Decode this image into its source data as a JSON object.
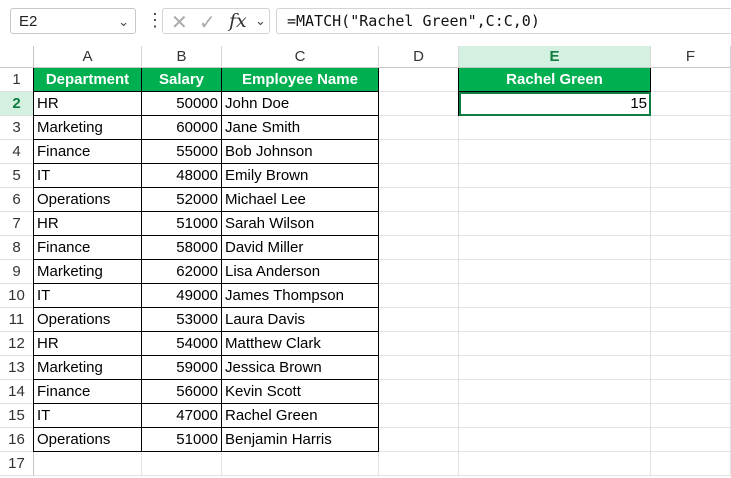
{
  "formula_bar": {
    "name_box": "E2",
    "formula": "=MATCH(\"Rachel Green\",C:C,0)",
    "icons": [
      "chevron-down-icon",
      "vertical-dots-icon",
      "cancel-icon",
      "enter-icon",
      "function-icon"
    ]
  },
  "columns": [
    "A",
    "B",
    "C",
    "D",
    "E",
    "F"
  ],
  "rows": [
    "1",
    "2",
    "3",
    "4",
    "5",
    "6",
    "7",
    "8",
    "9",
    "10",
    "11",
    "12",
    "13",
    "14",
    "15",
    "16",
    "17"
  ],
  "table": {
    "headers": [
      "Department",
      "Salary",
      "Employee Name"
    ],
    "records": [
      [
        "HR",
        "50000",
        "John Doe"
      ],
      [
        "Marketing",
        "60000",
        "Jane Smith"
      ],
      [
        "Finance",
        "55000",
        "Bob Johnson"
      ],
      [
        "IT",
        "48000",
        "Emily Brown"
      ],
      [
        "Operations",
        "52000",
        "Michael Lee"
      ],
      [
        "HR",
        "51000",
        "Sarah Wilson"
      ],
      [
        "Finance",
        "58000",
        "David Miller"
      ],
      [
        "Marketing",
        "62000",
        "Lisa Anderson"
      ],
      [
        "IT",
        "49000",
        "James Thompson"
      ],
      [
        "Operations",
        "53000",
        "Laura Davis"
      ],
      [
        "HR",
        "54000",
        "Matthew Clark"
      ],
      [
        "Marketing",
        "59000",
        "Jessica Brown"
      ],
      [
        "Finance",
        "56000",
        "Kevin Scott"
      ],
      [
        "IT",
        "47000",
        "Rachel Green"
      ],
      [
        "Operations",
        "51000",
        "Benjamin Harris"
      ]
    ]
  },
  "lookup": {
    "header": "Rachel Green",
    "result": "15"
  },
  "colors": {
    "header_fill": "#00b050",
    "header_text": "#ffffff",
    "selection": "#107c41"
  }
}
